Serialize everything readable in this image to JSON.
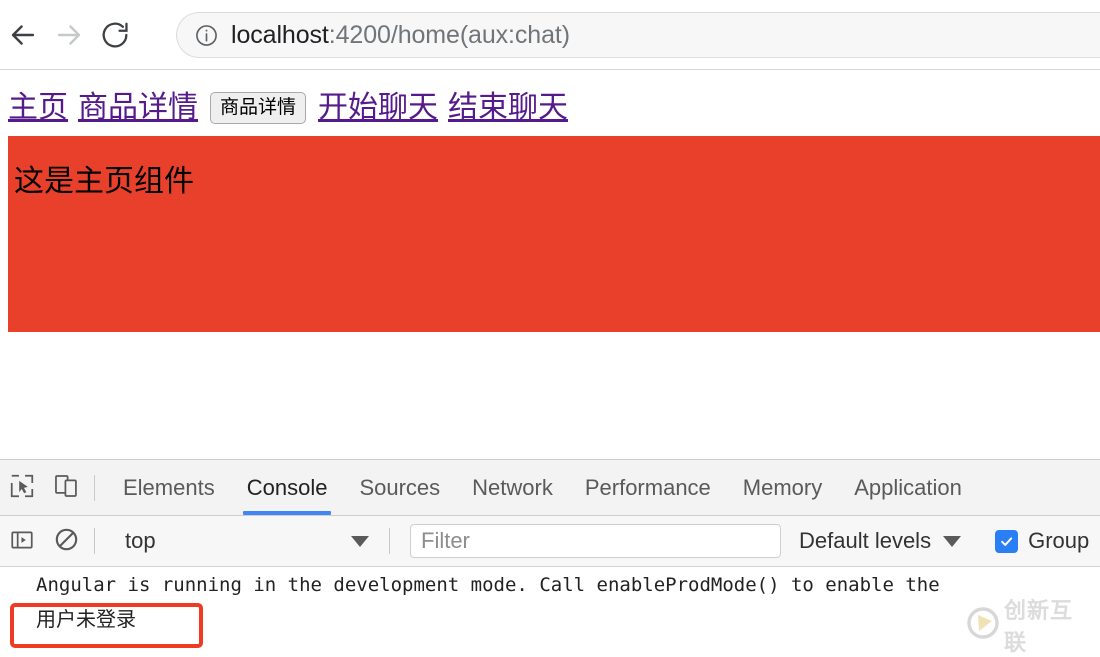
{
  "browser": {
    "back_icon": "arrow-left-icon",
    "forward_icon": "arrow-right-icon",
    "reload_icon": "reload-icon",
    "info_icon": "info-circle-icon",
    "url_host": "localhost",
    "url_rest": ":4200/home(aux:chat)",
    "url_full": "localhost:4200/home(aux:chat)"
  },
  "page": {
    "nav_links": [
      {
        "label": "主页"
      },
      {
        "label": "商品详情"
      },
      {
        "label": "开始聊天"
      },
      {
        "label": "结束聊天"
      }
    ],
    "detail_button_label": "商品详情",
    "panel_text": "这是主页组件",
    "panel_color": "#e8402a",
    "link_color": "#551a8b"
  },
  "devtools": {
    "inspect_icon": "cursor-select-icon",
    "device_toolbar_icon": "device-toggle-icon",
    "tabs": [
      {
        "label": "Elements",
        "active": false
      },
      {
        "label": "Console",
        "active": true
      },
      {
        "label": "Sources",
        "active": false
      },
      {
        "label": "Network",
        "active": false
      },
      {
        "label": "Performance",
        "active": false
      },
      {
        "label": "Memory",
        "active": false
      },
      {
        "label": "Application",
        "active": false
      }
    ],
    "active_tab_color": "#4285f4",
    "toolbar": {
      "sidebar_icon": "console-sidebar-toggle-icon",
      "clear_icon": "clear-console-icon",
      "context_value": "top",
      "filter_placeholder": "Filter",
      "filter_value": "",
      "levels_value": "Default levels",
      "group_label": "Group",
      "group_checked": true,
      "checkbox_color": "#2b7ff5"
    },
    "console_messages": [
      {
        "text": "Angular is running in the development mode. Call enableProdMode() to enable the"
      },
      {
        "text": "用户未登录"
      }
    ]
  },
  "annotation": {
    "color": "#ef3b24"
  },
  "watermark": {
    "text": "创新互联",
    "logo_icon": "cx-logo-icon"
  }
}
